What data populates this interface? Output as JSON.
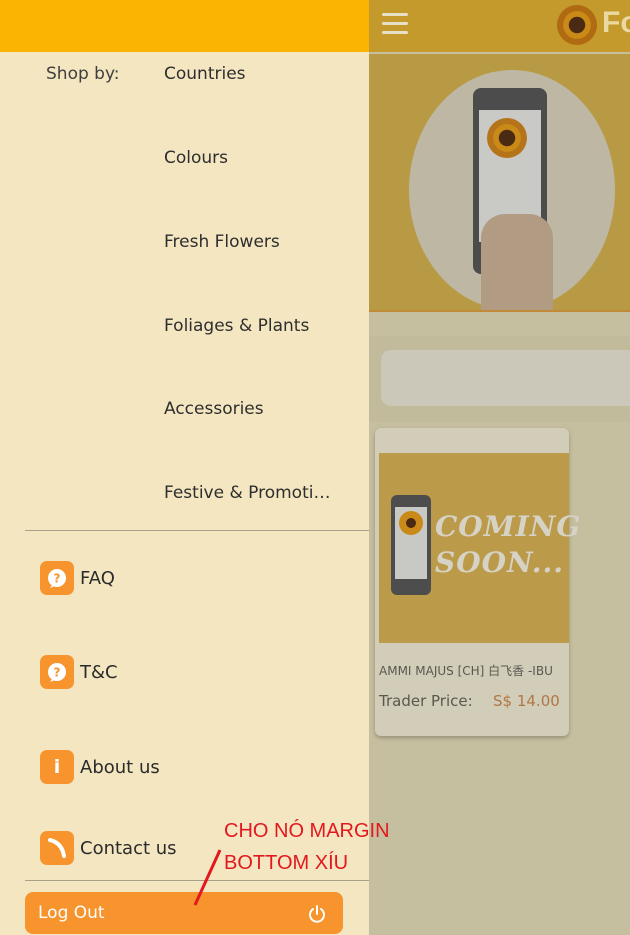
{
  "app": {
    "logo_text": "Fo"
  },
  "drawer": {
    "shop_by_label": "Shop by:",
    "categories": [
      "Countries",
      "Colours",
      "Fresh Flowers",
      "Foliages & Plants",
      "Accessories",
      "Festive & Promoti…"
    ],
    "links": [
      {
        "label": "FAQ",
        "icon": "faq-icon",
        "glyph": "?"
      },
      {
        "label": "T&C",
        "icon": "tc-icon",
        "glyph": "?"
      },
      {
        "label": "About us",
        "icon": "info-icon",
        "glyph": "i"
      },
      {
        "label": "Contact us",
        "icon": "phone-icon",
        "glyph": ""
      }
    ],
    "logout_label": "Log Out"
  },
  "product": {
    "image_text_1": "COMING",
    "image_text_2": "SOON...",
    "name": "AMMI MAJUS [CH] 白飞香  -IBU",
    "price_label": "Trader Price:",
    "price": "S$ 14.00"
  },
  "annotation": {
    "line1": "CHO NÓ MARGIN",
    "line2": "BOTTOM XÍU"
  },
  "colors": {
    "drawer_header": "#fbb401",
    "drawer_bg": "#f3e6c1",
    "accent_orange": "#f7942e",
    "annotation_red": "#e3181e"
  }
}
